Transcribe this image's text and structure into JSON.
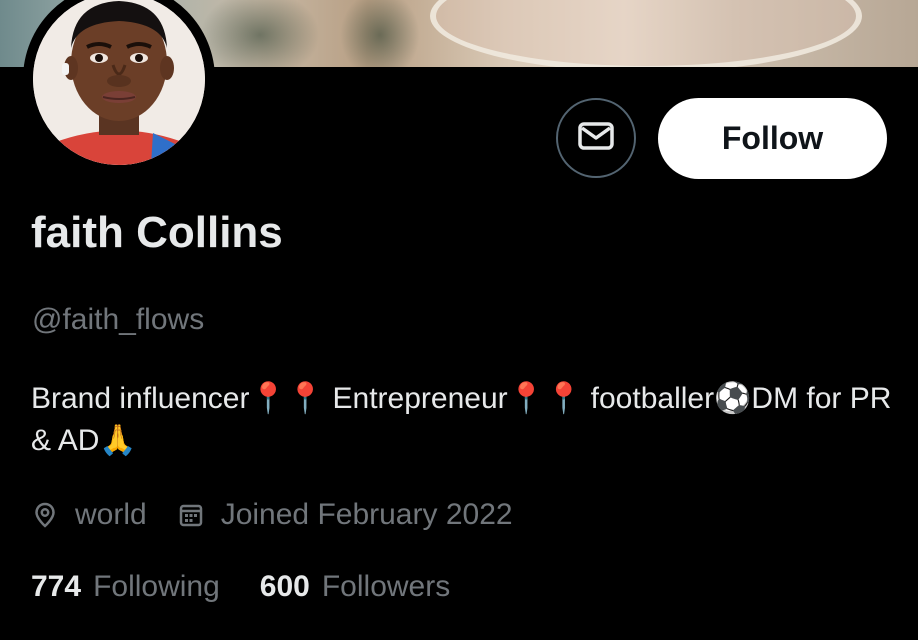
{
  "profile": {
    "display_name": "faith Collins",
    "handle": "@faith_flows",
    "bio": "Brand influencer📍📍 Entrepreneur📍📍  footballer⚽DM for PR & AD🙏",
    "location": "world",
    "joined": "Joined February 2022",
    "following_count": "774",
    "following_label": "Following",
    "followers_count": "600",
    "followers_label": "Followers"
  },
  "actions": {
    "message_icon": "envelope-icon",
    "follow_label": "Follow"
  },
  "icons": {
    "location": "location-pin-icon",
    "calendar": "calendar-icon"
  },
  "colors": {
    "background": "#000000",
    "primary_text": "#e7e9ea",
    "secondary_text": "#71767b",
    "button_border": "#536471",
    "follow_bg": "#ffffff",
    "follow_text": "#0f1419"
  }
}
